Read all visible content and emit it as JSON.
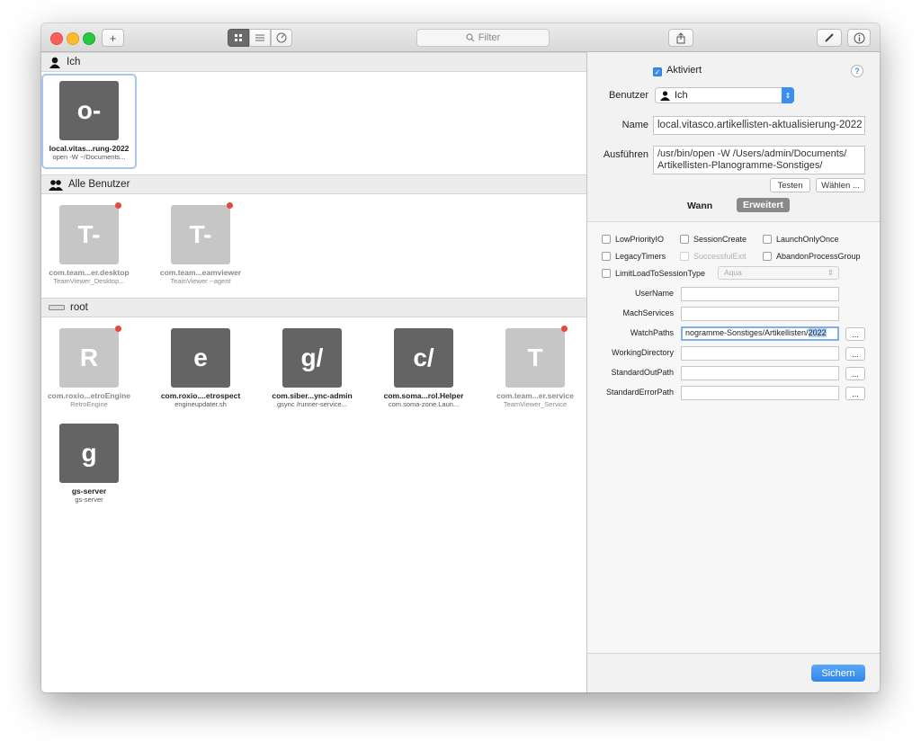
{
  "toolbar": {
    "add_label": "+",
    "filter_placeholder": "Filter",
    "view_modes": [
      "grid",
      "list",
      "gauge"
    ]
  },
  "colors": {
    "accent": "#3c8ff0",
    "tile_dark": "#646464",
    "tile_dim": "#c6c6c6",
    "badge_red": "#e24a3b"
  },
  "groups": [
    {
      "label": "Ich",
      "items": [
        {
          "glyph": "o-",
          "name": "local.vitas...rung-2022",
          "sub": "open -W ~/Documents...",
          "dim": false,
          "selected": true
        }
      ]
    },
    {
      "label": "Alle Benutzer",
      "items": [
        {
          "glyph": "T-",
          "name": "com.team...er.desktop",
          "sub": "TeamViewer_Desktop...",
          "dim": true
        },
        {
          "glyph": "T-",
          "name": "com.team...eamviewer",
          "sub": "TeamViewer --agent",
          "dim": true
        }
      ]
    },
    {
      "label": "root",
      "items": [
        {
          "glyph": "R",
          "name": "com.roxio...etroEngine",
          "sub": "RetroEngine",
          "dim": true
        },
        {
          "glyph": "e",
          "name": "com.roxio....etrospect",
          "sub": "engineupdater.sh",
          "dim": false
        },
        {
          "glyph": "g/",
          "name": "com.siber...ync-admin",
          "sub": "gsync /runner-service...",
          "dim": false
        },
        {
          "glyph": "c/",
          "name": "com.soma...rol.Helper",
          "sub": "com.soma-zone.Laun...",
          "dim": false
        },
        {
          "glyph": "T",
          "name": "com.team...er.service",
          "sub": "TeamViewer_Service",
          "dim": true
        },
        {
          "glyph": "g",
          "name": "gs-server",
          "sub": "gs-server",
          "dim": false
        }
      ]
    }
  ],
  "detail": {
    "activated_label": "Aktiviert",
    "help_label": "?",
    "user_label": "Benutzer",
    "user_value": "Ich",
    "name_label": "Name",
    "name_value": "local.vitasco.artikellisten-aktualisierung-2022",
    "run_label": "Ausführen",
    "run_line1": "/usr/bin/open -W /Users/admin/Documents/",
    "run_line2": "Artikellisten-Planogramme-Sonstiges/",
    "test_label": "Testen",
    "choose_label": "Wählen ...",
    "tab_when": "Wann",
    "tab_advanced": "Erweitert",
    "options": {
      "low_priority_io": "LowPriorityIO",
      "session_create": "SessionCreate",
      "launch_only_once": "LaunchOnlyOnce",
      "legacy_timers": "LegacyTimers",
      "successful_exit": "SuccessfulExit",
      "abandon_process_group": "AbandonProcessGroup",
      "limit_load": "LimitLoadToSessionType",
      "session_type": "Aqua"
    },
    "keys": {
      "username": "UserName",
      "mach_services": "MachServices",
      "watch_paths": "WatchPaths",
      "watch_paths_value_plain": "nogramme-Sonstiges/Artikellisten/",
      "watch_paths_value_sel": "2022",
      "working_directory": "WorkingDirectory",
      "stdout_path": "StandardOutPath",
      "stderr_path": "StandardErrorPath",
      "dots": "..."
    },
    "save_label": "Sichern"
  }
}
